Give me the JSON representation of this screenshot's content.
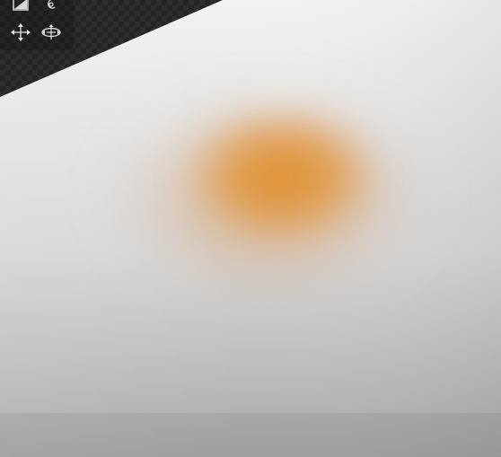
{
  "viewport": {
    "background": "checkerboard",
    "surface_color": "#d8d8d8",
    "stain_color": "#e48f27"
  },
  "toolbar": {
    "tools": [
      {
        "name": "surface-tool",
        "icon": "surface-icon"
      },
      {
        "name": "brush-tool",
        "icon": "brush-icon"
      },
      {
        "name": "pan-tool",
        "icon": "pan-icon"
      },
      {
        "name": "orbit-tool",
        "icon": "orbit-icon"
      }
    ]
  }
}
